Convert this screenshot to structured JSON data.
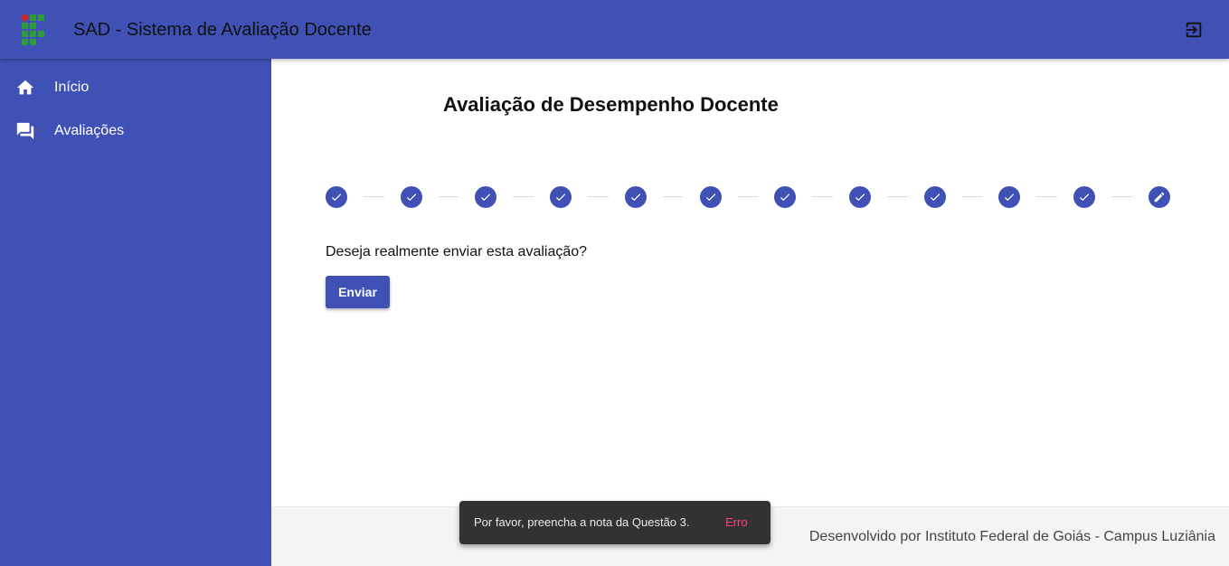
{
  "header": {
    "app_title": "SAD - Sistema de Avaliação Docente",
    "logout_icon": "logout-icon",
    "accent": "#3f51b5"
  },
  "sidebar": {
    "items": [
      {
        "label": "Início",
        "icon": "home-icon"
      },
      {
        "label": "Avaliações",
        "icon": "forum-icon"
      }
    ]
  },
  "main": {
    "title": "Avaliação de Desempenho Docente",
    "stepper": {
      "total_steps": 12,
      "completed_steps": 11,
      "completed_icon": "check-icon",
      "current_icon": "edit-icon"
    },
    "question": "Deseja realmente enviar esta avaliação?",
    "send_label": "Enviar"
  },
  "footer": {
    "text": "Desenvolvido por Instituto Federal de Goiás - Campus Luziânia"
  },
  "snackbar": {
    "message": "Por favor, preencha a nota da Questão 3.",
    "action": "Erro",
    "action_color": "#ff4081"
  }
}
